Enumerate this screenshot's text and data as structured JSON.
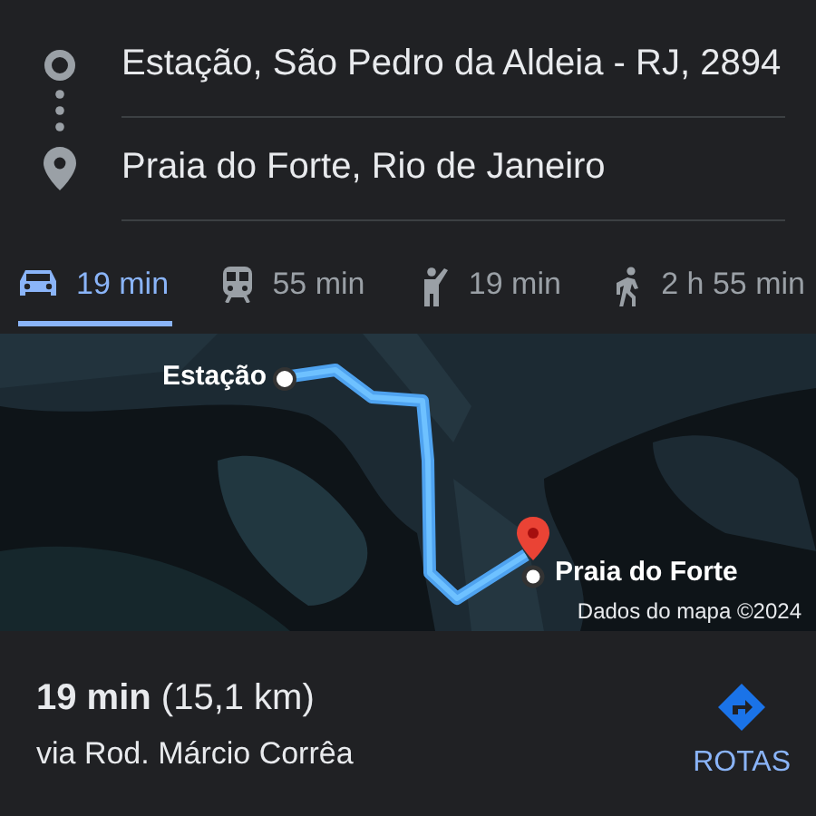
{
  "route": {
    "origin": "Estação, São Pedro da Aldeia - RJ, 2894",
    "destination": "Praia do Forte, Rio de Janeiro"
  },
  "modes": [
    {
      "kind": "car",
      "label": "19 min",
      "selected": true
    },
    {
      "kind": "transit",
      "label": "55 min",
      "selected": false
    },
    {
      "kind": "ride",
      "label": "19 min",
      "selected": false
    },
    {
      "kind": "walk",
      "label": "2 h 55 min",
      "selected": false
    }
  ],
  "map": {
    "kind": "picture",
    "origin_label": "Estação",
    "destination_label": "Praia do Forte",
    "attribution": "Dados do mapa ©2024"
  },
  "summary": {
    "duration_distance": "**19 min** (15,1 km)",
    "via": "via Rod. Márcio Corrêa"
  },
  "action": {
    "label": "ROTAS"
  }
}
